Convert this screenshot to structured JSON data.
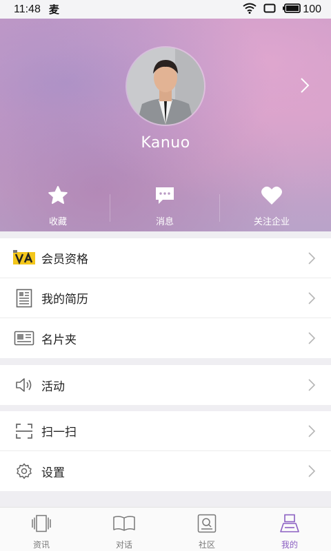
{
  "status_bar": {
    "time": "11:48",
    "app_glyph": "麦",
    "battery_level": "100"
  },
  "profile": {
    "username": "Kanuo"
  },
  "quick_actions": [
    {
      "label": "收藏",
      "icon": "star-icon"
    },
    {
      "label": "消息",
      "icon": "message-icon"
    },
    {
      "label": "关注企业",
      "icon": "heart-icon"
    }
  ],
  "menu_groups": [
    [
      {
        "label": "会员资格",
        "icon": "vip-badge-icon"
      },
      {
        "label": "我的简历",
        "icon": "resume-icon"
      },
      {
        "label": "名片夹",
        "icon": "business-card-icon"
      }
    ],
    [
      {
        "label": "活动",
        "icon": "speaker-icon"
      }
    ],
    [
      {
        "label": "扫一扫",
        "icon": "scan-icon"
      },
      {
        "label": "设置",
        "icon": "gear-icon"
      }
    ]
  ],
  "bottom_nav": [
    {
      "label": "资讯",
      "icon": "news-icon",
      "active": false
    },
    {
      "label": "对话",
      "icon": "book-icon",
      "active": false
    },
    {
      "label": "社区",
      "icon": "community-icon",
      "active": false
    },
    {
      "label": "我的",
      "icon": "profile-icon",
      "active": true
    }
  ],
  "colors": {
    "accent": "#8b5fc2",
    "page_bg": "#efeef2",
    "header_tint": "#d3a0c8"
  }
}
